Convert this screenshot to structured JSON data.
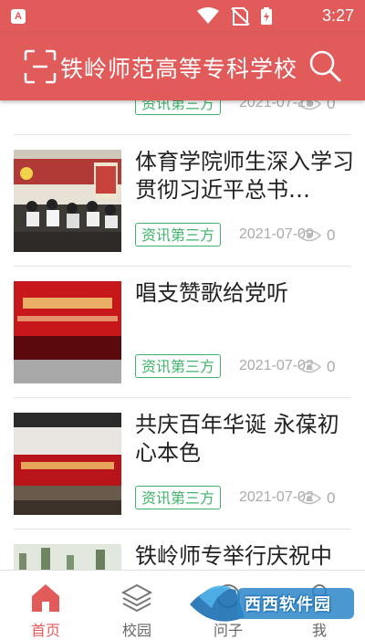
{
  "status_bar": {
    "time": "3:27",
    "app_icon_letter": "A"
  },
  "header": {
    "title": "铁岭师范高等专科学校"
  },
  "articles": [
    {
      "title": "",
      "tag": "资讯第三方",
      "date": "2021-07-15",
      "views": "0"
    },
    {
      "title": "体育学院师生深入学习贯彻习近平总书…",
      "tag": "资讯第三方",
      "date": "2021-07-09",
      "views": "0"
    },
    {
      "title": "唱支赞歌给党听",
      "tag": "资讯第三方",
      "date": "2021-07-02",
      "views": "0"
    },
    {
      "title": "共庆百年华诞 永葆初心本色",
      "tag": "资讯第三方",
      "date": "2021-07-02",
      "views": "0"
    },
    {
      "title": "铁岭师专举行庆祝中",
      "tag": "",
      "date": "",
      "views": ""
    }
  ],
  "tabs": [
    {
      "label": "首页",
      "icon": "home-icon",
      "active": true
    },
    {
      "label": "校园",
      "icon": "layers-icon",
      "active": false
    },
    {
      "label": "问子",
      "icon": "chat-icon",
      "active": false
    },
    {
      "label": "我",
      "icon": "user-icon",
      "active": false
    }
  ],
  "watermark": {
    "text": "西西软件园"
  },
  "colors": {
    "brand_red": "#e25b5b",
    "tag_green": "#3fb36b",
    "meta_gray": "#aaaaaa"
  }
}
